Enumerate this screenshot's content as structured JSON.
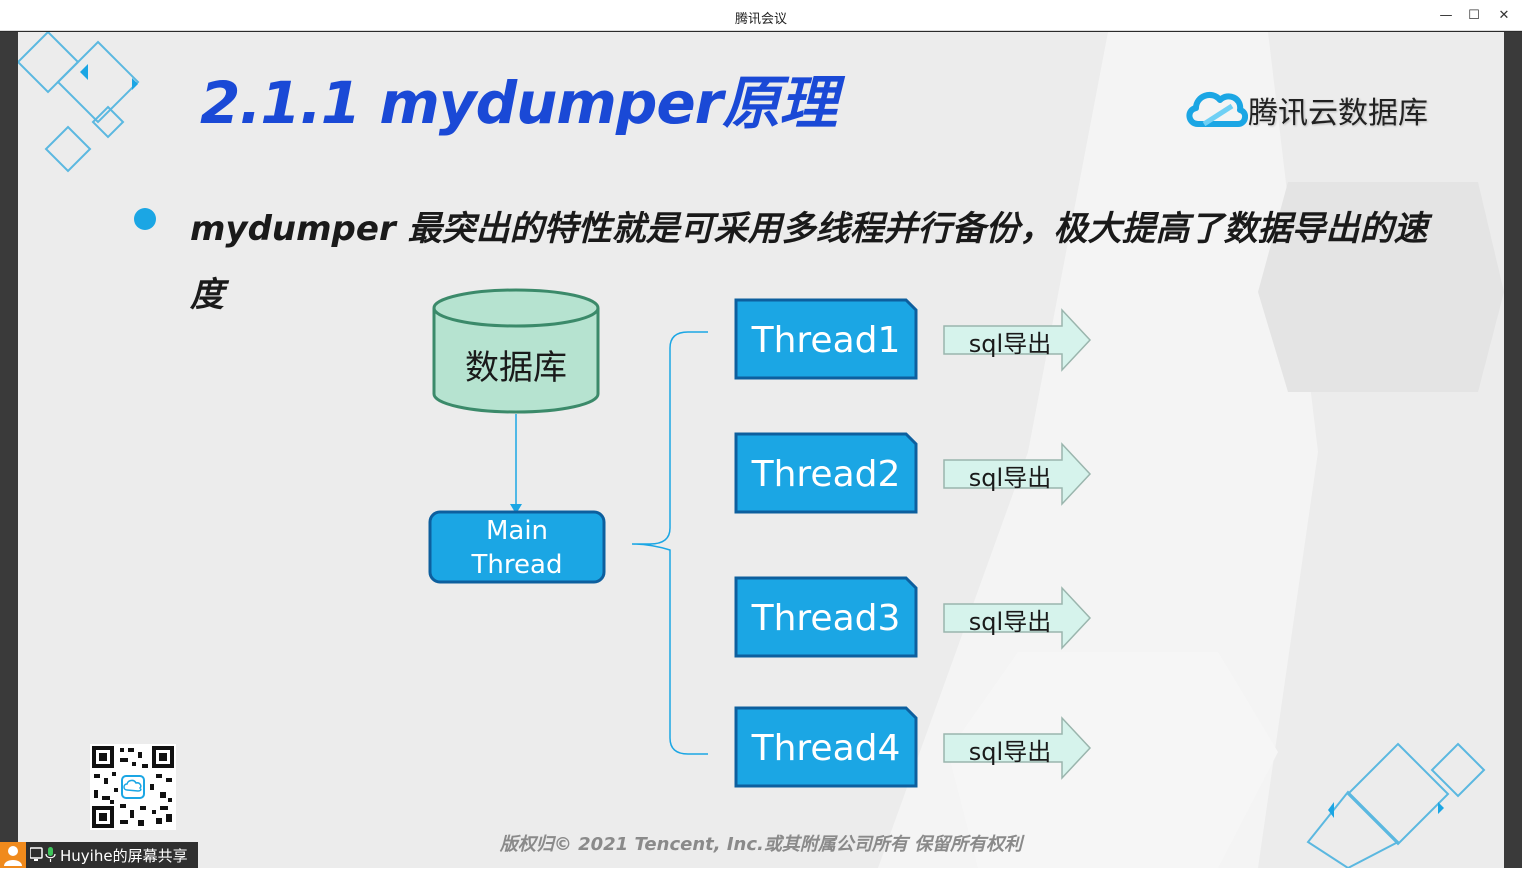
{
  "window": {
    "title": "腾讯会议",
    "controls": {
      "minimize": "—",
      "maximize": "☐",
      "close": "✕"
    }
  },
  "slide": {
    "title": "2.1.1 mydumper原理",
    "brand": "腾讯云数据库",
    "bullet": "mydumper 最突出的特性就是可采用多线程并行备份，极大提高了数据导出的速度",
    "footer": "版权归© 2021 Tencent, Inc.或其附属公司所有 保留所有权利"
  },
  "diagram": {
    "database": "数据库",
    "main_thread": [
      "Main",
      "Thread"
    ],
    "threads": [
      "Thread1",
      "Thread2",
      "Thread3",
      "Thread4"
    ],
    "export_label": "sql导出",
    "colors": {
      "thread_fill": "#1ba6e4",
      "db_fill": "#b6e3d0",
      "db_stroke": "#3b8a6a",
      "arrow_fill": "#d6f3ec"
    }
  },
  "share_bar": {
    "label": "Huyihe的屏幕共享"
  }
}
